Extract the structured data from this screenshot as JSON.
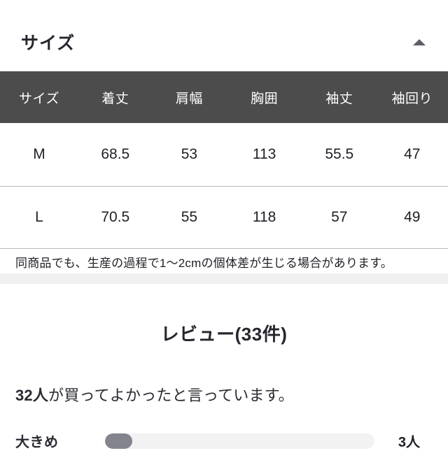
{
  "size_section": {
    "title": "サイズ",
    "collapse_icon": "caret-up-icon",
    "table": {
      "headers": [
        "サイズ",
        "着丈",
        "肩幅",
        "胸囲",
        "袖丈",
        "袖回り"
      ],
      "rows": [
        [
          "M",
          "68.5",
          "53",
          "113",
          "55.5",
          "47"
        ],
        [
          "L",
          "70.5",
          "55",
          "118",
          "57",
          "49"
        ]
      ]
    },
    "note": "同商品でも、生産の過程で1〜2cmの個体差が生じる場合があります。"
  },
  "reviews_section": {
    "title": "レビュー(33件)",
    "summary": {
      "count": "32人",
      "text": "が買ってよかったと言っています。"
    },
    "ratings": [
      {
        "label": "大きめ",
        "count": "3人",
        "fill_percent": 10
      }
    ]
  },
  "colors": {
    "table_header_bg": "#4c4c4c",
    "bar_fill": "#84848e",
    "bar_track": "#f2f2f2",
    "section_divider": "#f0f0f0",
    "text": "#2b2b33"
  }
}
